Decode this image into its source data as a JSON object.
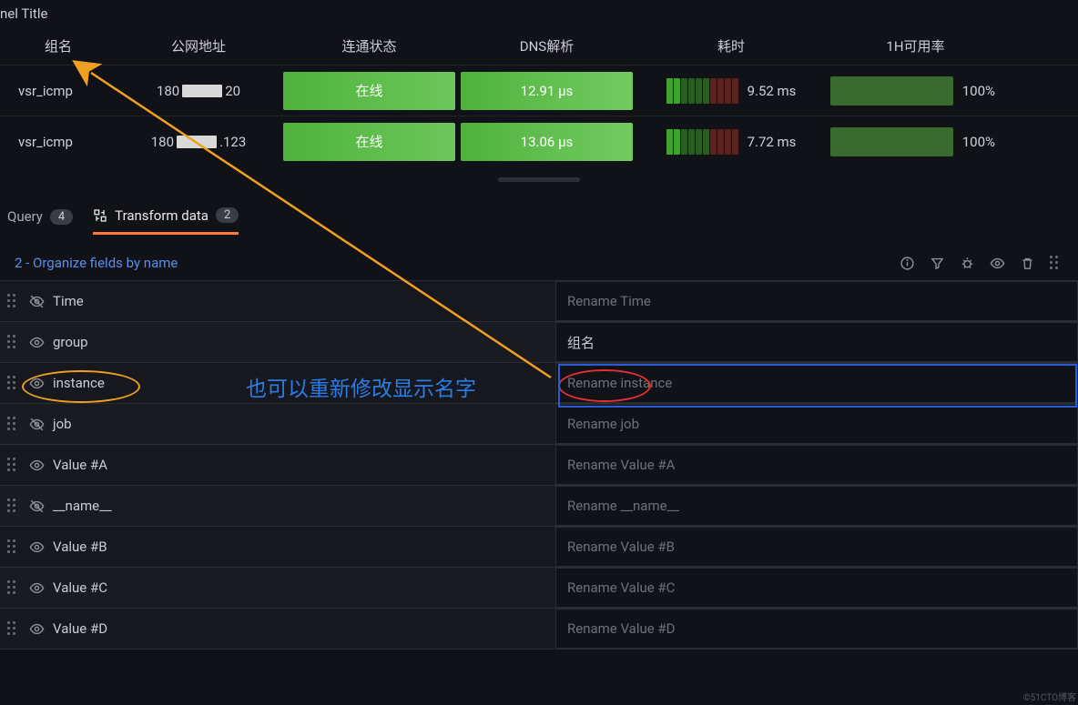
{
  "panel": {
    "title": "nel Title"
  },
  "table": {
    "headers": {
      "c1": "组名",
      "c2": "公网地址",
      "c3": "连通状态",
      "c4": "DNS解析",
      "c5": "耗时",
      "c6": "1H可用率"
    },
    "rows": [
      {
        "group": "vsr_icmp",
        "ip_prefix": "180",
        "ip_suffix": "20",
        "status": "在线",
        "dns": "12.91 μs",
        "latency": "9.52 ms",
        "avail": "100%"
      },
      {
        "group": "vsr_icmp",
        "ip_prefix": "180",
        "ip_suffix": ".123",
        "status": "在线",
        "dns": "13.06 μs",
        "latency": "7.72 ms",
        "avail": "100%"
      }
    ]
  },
  "tabs": {
    "query": {
      "label": "Query",
      "count": "4"
    },
    "transform": {
      "label": "Transform data",
      "count": "2"
    }
  },
  "transform": {
    "title": "2 - Organize fields by name",
    "fields": [
      {
        "visible": false,
        "name": "Time",
        "placeholder": "Rename Time",
        "value": ""
      },
      {
        "visible": true,
        "name": "group",
        "placeholder": "Rename group",
        "value": "组名"
      },
      {
        "visible": true,
        "name": "instance",
        "placeholder": "Rename instance",
        "value": ""
      },
      {
        "visible": false,
        "name": "job",
        "placeholder": "Rename job",
        "value": ""
      },
      {
        "visible": true,
        "name": "Value #A",
        "placeholder": "Rename Value #A",
        "value": ""
      },
      {
        "visible": false,
        "name": "__name__",
        "placeholder": "Rename __name__",
        "value": ""
      },
      {
        "visible": true,
        "name": "Value #B",
        "placeholder": "Rename Value #B",
        "value": ""
      },
      {
        "visible": true,
        "name": "Value #C",
        "placeholder": "Rename Value #C",
        "value": ""
      },
      {
        "visible": true,
        "name": "Value #D",
        "placeholder": "Rename Value #D",
        "value": ""
      }
    ]
  },
  "annotations": {
    "blue_text": "也可以重新修改显示名字"
  },
  "watermark": "©51CTO博客"
}
